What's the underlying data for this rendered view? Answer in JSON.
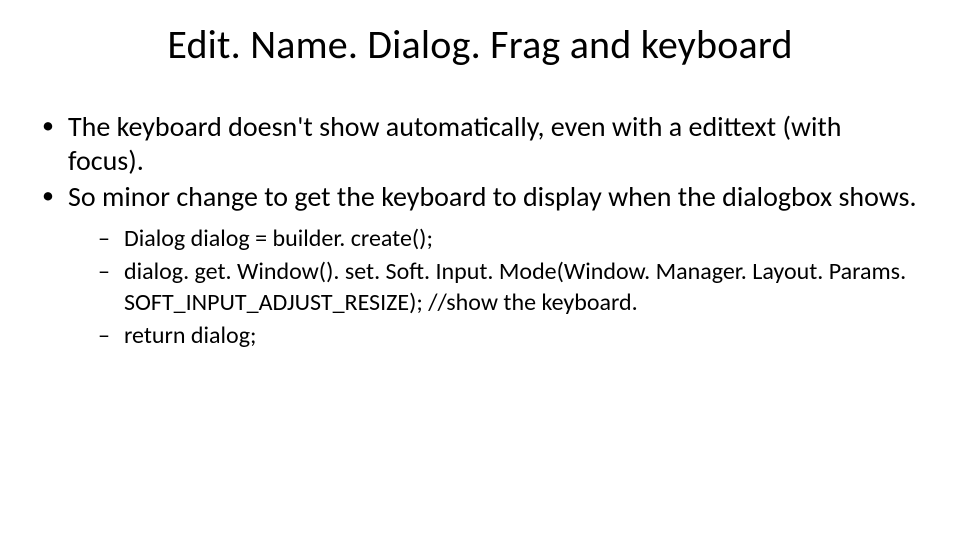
{
  "title": "Edit. Name. Dialog. Frag and keyboard",
  "bullets": {
    "b1": "The keyboard doesn't show automatically, even with a edittext (with focus).",
    "b2": "So minor change to get the keyboard to display when the dialogbox shows.",
    "sub": {
      "s1": " Dialog dialog = builder. create();",
      "s2": "dialog. get. Window(). set. Soft. Input. Mode(Window. Manager. Layout. Params. SOFT_INPUT_ADJUST_RESIZE);  //show the keyboard.",
      "s3": "return dialog;"
    }
  }
}
